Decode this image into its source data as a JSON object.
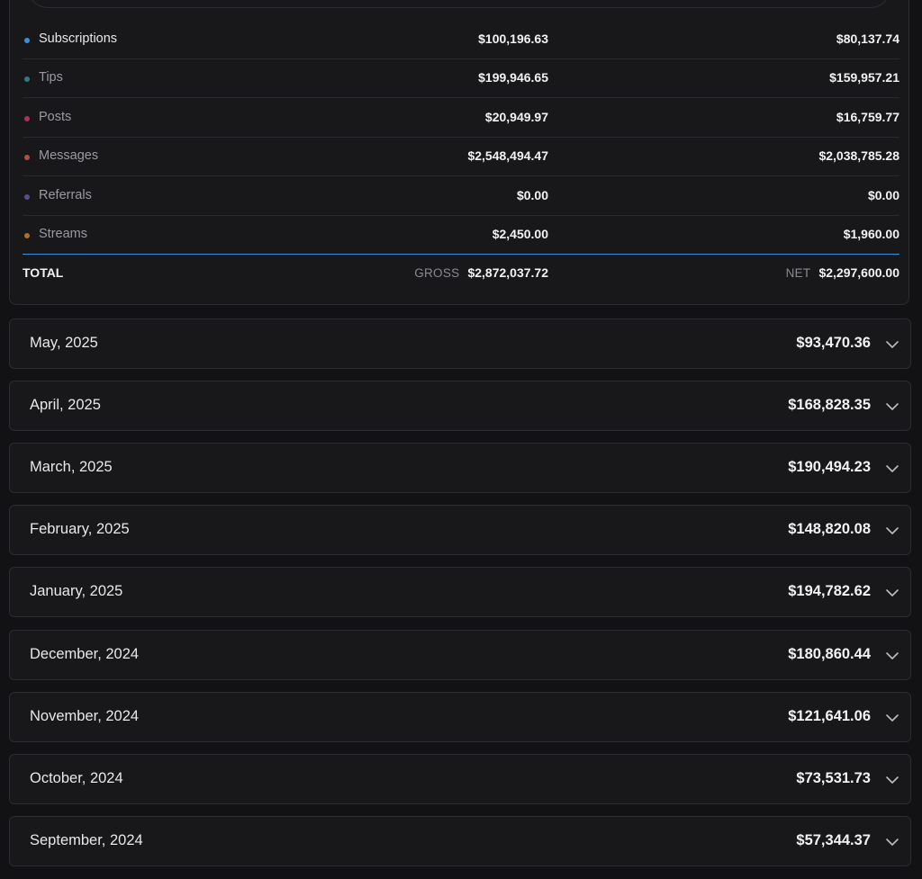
{
  "breakdown": {
    "rows": [
      {
        "label": "Subscriptions",
        "gross": "$100,196.63",
        "net": "$80,137.74",
        "color": "#3b8fd6"
      },
      {
        "label": "Tips",
        "gross": "$199,946.65",
        "net": "$159,957.21",
        "color": "#2f7c86"
      },
      {
        "label": "Posts",
        "gross": "$20,949.97",
        "net": "$16,759.77",
        "color": "#a8345a"
      },
      {
        "label": "Messages",
        "gross": "$2,548,494.47",
        "net": "$2,038,785.28",
        "color": "#b0503e"
      },
      {
        "label": "Referrals",
        "gross": "$0.00",
        "net": "$0.00",
        "color": "#5e4a8e"
      },
      {
        "label": "Streams",
        "gross": "$2,450.00",
        "net": "$1,960.00",
        "color": "#b06e2a"
      }
    ],
    "total": {
      "label": "TOTAL",
      "gross_key": "GROSS",
      "gross": "$2,872,037.72",
      "net_key": "NET",
      "net": "$2,297,600.00"
    }
  },
  "months": [
    {
      "name": "May, 2025",
      "amount": "$93,470.36"
    },
    {
      "name": "April, 2025",
      "amount": "$168,828.35"
    },
    {
      "name": "March, 2025",
      "amount": "$190,494.23"
    },
    {
      "name": "February, 2025",
      "amount": "$148,820.08"
    },
    {
      "name": "January, 2025",
      "amount": "$194,782.62"
    },
    {
      "name": "December, 2024",
      "amount": "$180,860.44"
    },
    {
      "name": "November, 2024",
      "amount": "$121,641.06"
    },
    {
      "name": "October, 2024",
      "amount": "$73,531.73"
    },
    {
      "name": "September, 2024",
      "amount": "$57,344.37"
    }
  ],
  "icons": {
    "expand": "chevron-down-icon"
  },
  "colors": {
    "background": "#121214",
    "card": "#18181b",
    "accent_line": "#3b8fd6"
  }
}
